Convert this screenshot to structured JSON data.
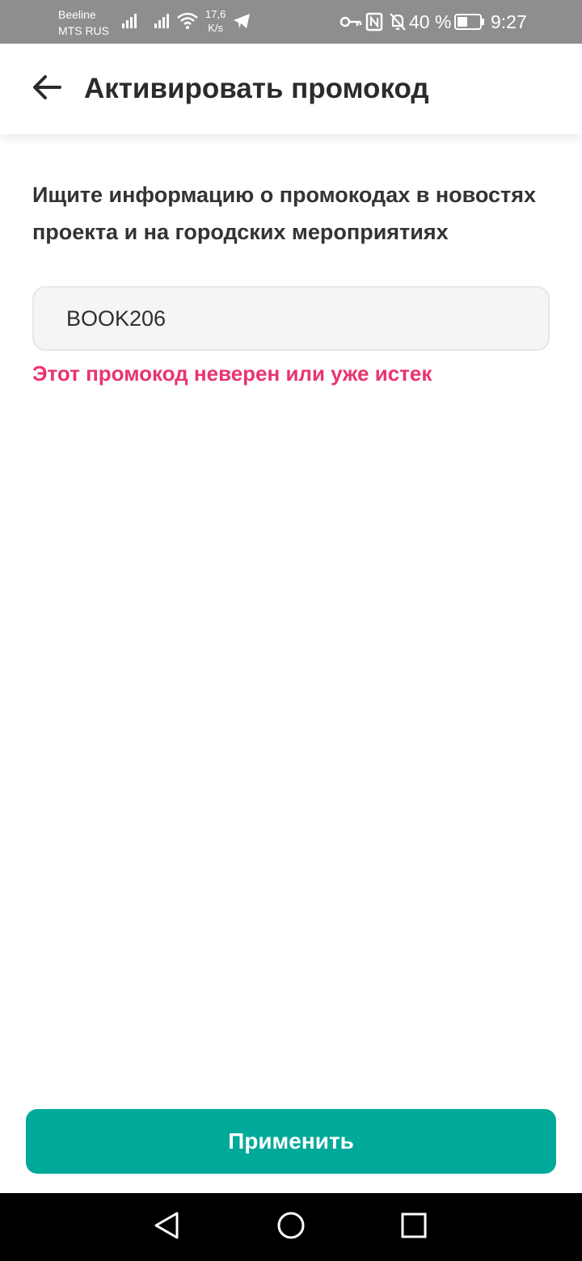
{
  "status_bar": {
    "carrier_1": "Beeline",
    "carrier_2": "MTS RUS",
    "speed_value": "17,6",
    "speed_unit": "K/s",
    "battery_percent": "40 %",
    "time": "9:27",
    "icons": [
      "signal-icon",
      "signal-icon",
      "wifi-icon",
      "telegram-icon",
      "key-icon",
      "nfc-icon",
      "bell-off-icon",
      "battery-icon"
    ]
  },
  "header": {
    "title": "Активировать промокод",
    "back_icon": "arrow-left-icon"
  },
  "main": {
    "hint": "Ищите информацию о промокодах в новостях проекта и на городских мероприятиях",
    "promo_input_value": "BOOK206",
    "error_text": "Этот промокод неверен или уже истек"
  },
  "footer": {
    "apply_label": "Применить"
  },
  "nav_bar": {
    "icons": [
      "back-triangle-icon",
      "home-circle-icon",
      "recents-square-icon"
    ]
  },
  "colors": {
    "accent": "#00a99a",
    "error": "#e8356d",
    "status_bar_bg": "#8e8e8e",
    "input_bg": "#f4f5f7"
  }
}
